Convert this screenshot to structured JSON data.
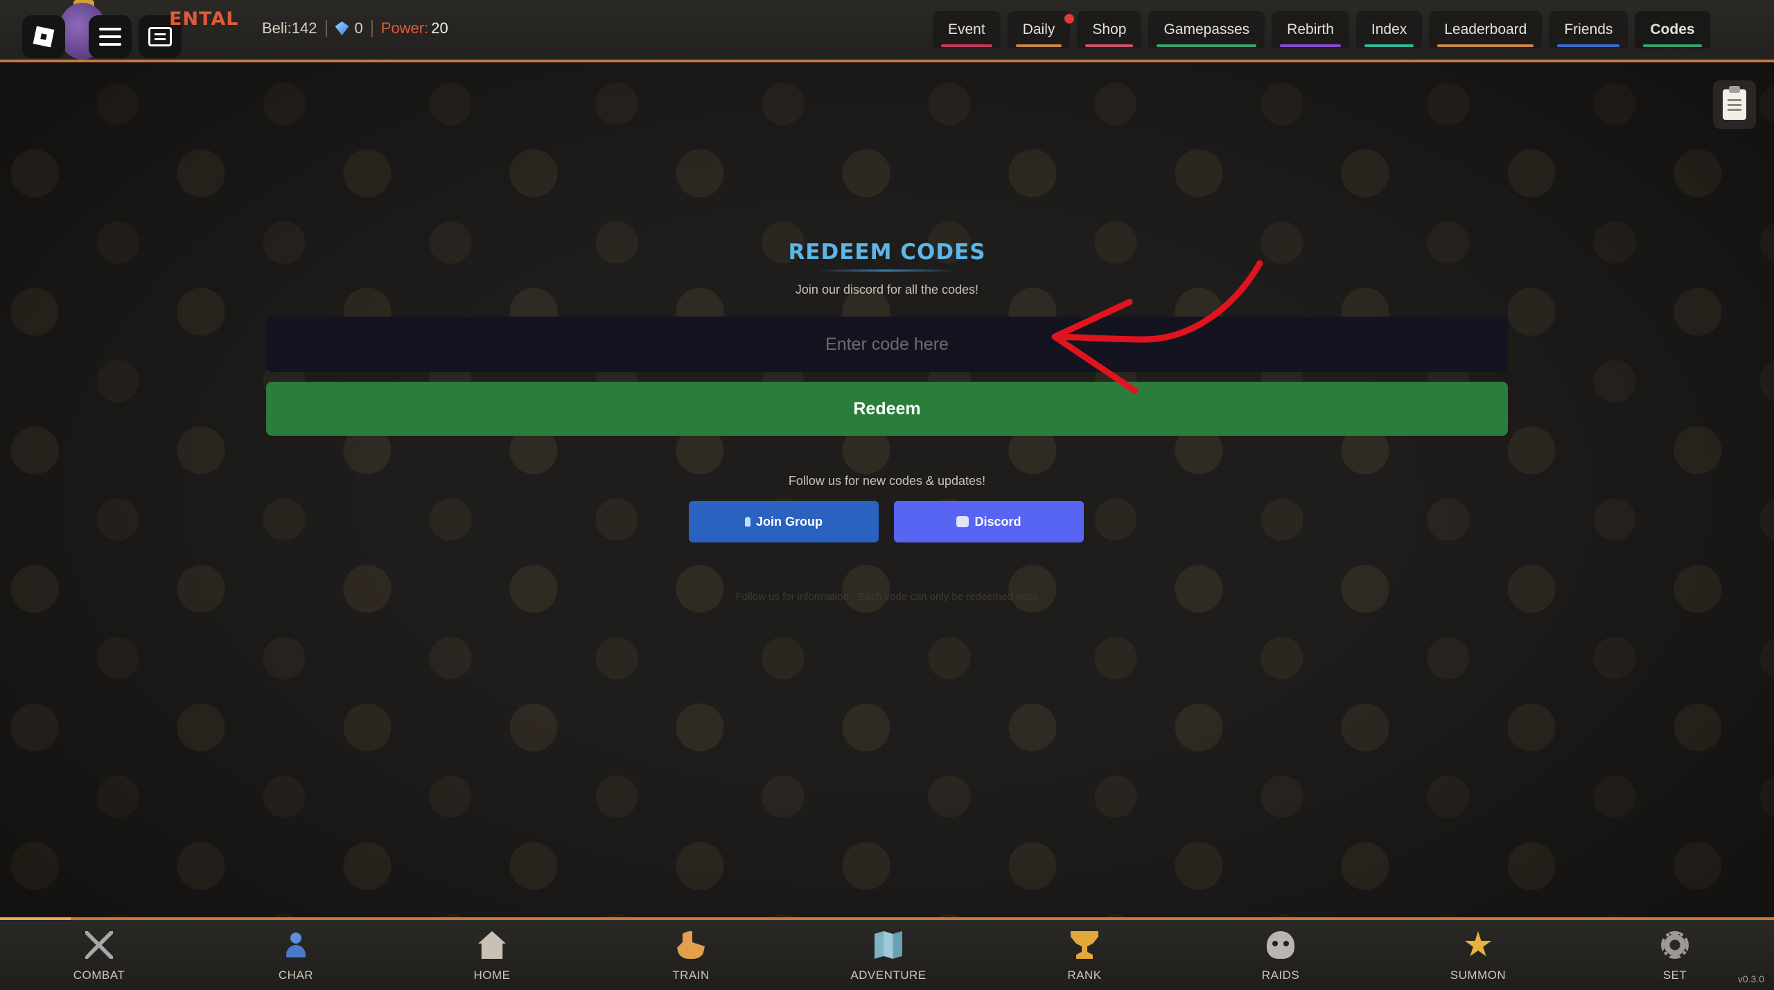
{
  "topbar": {
    "brand_fragment": "ENTAL",
    "beli_label": "Beli:",
    "beli_value": "142",
    "gems_value": "0",
    "power_label": "Power:",
    "power_value": "20",
    "tabs": [
      {
        "label": "Event",
        "color": "#c0385a",
        "active": false
      },
      {
        "label": "Daily",
        "color": "#c7864a",
        "active": false,
        "notification": true
      },
      {
        "label": "Shop",
        "color": "#d0506a",
        "active": false
      },
      {
        "label": "Gamepasses",
        "color": "#3aa36a",
        "active": false
      },
      {
        "label": "Rebirth",
        "color": "#8a4ad0",
        "active": false
      },
      {
        "label": "Index",
        "color": "#2fb89a",
        "active": false
      },
      {
        "label": "Leaderboard",
        "color": "#c7864a",
        "active": false
      },
      {
        "label": "Friends",
        "color": "#3a6ad0",
        "active": false
      },
      {
        "label": "Codes",
        "color": "#3aa36a",
        "active": true
      }
    ]
  },
  "redeem": {
    "title": "REDEEM CODES",
    "subtitle": "Join our discord for all the codes!",
    "input_placeholder": "Enter code here",
    "input_value": "",
    "redeem_label": "Redeem",
    "follow_text": "Follow us for new codes & updates!",
    "join_group_label": "Join Group",
    "discord_label": "Discord",
    "footnote": "Follow us for information - Each code can only be redeemed once"
  },
  "colors": {
    "accent_orange": "#c9773a",
    "title_blue": "#5cb6e6",
    "redeem_green": "#2a7d3a",
    "join_blue": "#2a62c0",
    "discord_purple": "#5865f2",
    "arrow_red": "#e0141e"
  },
  "bottom_nav": {
    "progress": 0.04,
    "items": [
      {
        "label": "COMBAT",
        "icon": "swords-icon"
      },
      {
        "label": "CHAR",
        "icon": "person-icon"
      },
      {
        "label": "HOME",
        "icon": "home-icon",
        "active": true
      },
      {
        "label": "TRAIN",
        "icon": "flexed-arm-icon"
      },
      {
        "label": "ADVENTURE",
        "icon": "map-icon"
      },
      {
        "label": "RANK",
        "icon": "trophy-icon"
      },
      {
        "label": "RAIDS",
        "icon": "skull-icon"
      },
      {
        "label": "SUMMON",
        "icon": "sparkle-icon"
      },
      {
        "label": "SET",
        "icon": "gear-icon"
      }
    ],
    "version": "v0.3.0"
  }
}
